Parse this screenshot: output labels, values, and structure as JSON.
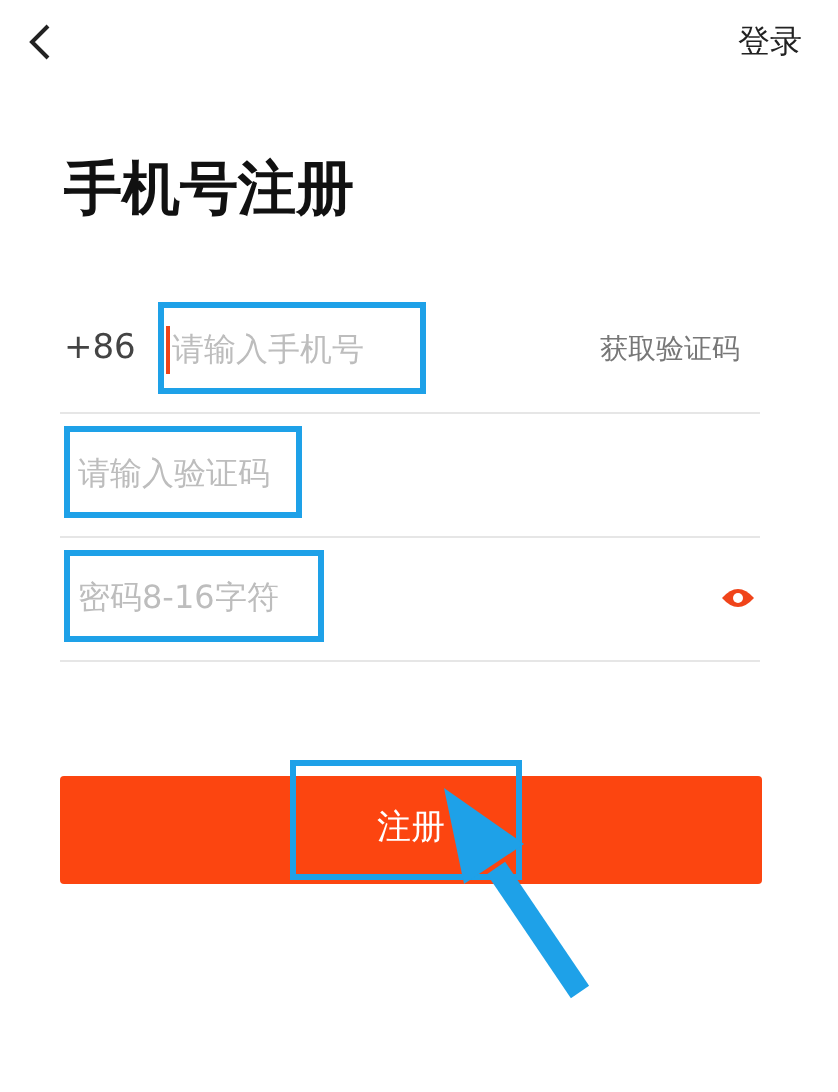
{
  "top_bar": {
    "login_link": "登录"
  },
  "title": "手机号注册",
  "fields": [
    {
      "kind": "phone",
      "prefix": "+86",
      "placeholder": "请输入手机号",
      "action": "获取验证码",
      "focused": true,
      "highlighted": true
    },
    {
      "kind": "code",
      "placeholder": "请输入验证码",
      "focused": false,
      "highlighted": true
    },
    {
      "kind": "password",
      "placeholder": "密码8-16字符",
      "focused": false,
      "highlighted": true,
      "show_toggle": true
    }
  ],
  "submit": {
    "label": "注册",
    "highlighted": true
  },
  "pointer_arrow": true
}
